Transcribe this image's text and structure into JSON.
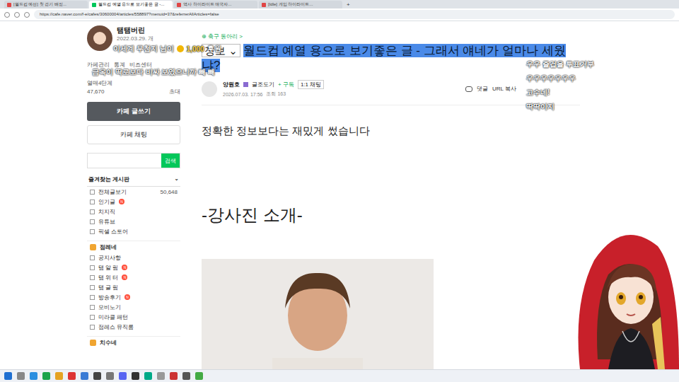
{
  "browser": {
    "tabs": [
      {
        "label": "[월드컵 예선] 첫 경기 배정...",
        "selected": false
      },
      {
        "label": "월드컵 예열 용으로 보기좋은 글 -...",
        "selected": true
      },
      {
        "label": "역사 하이라이트 애국자...",
        "selected": false
      },
      {
        "label": "[Idle] 게임 하이라이트...",
        "selected": false
      }
    ],
    "new_tab": "+",
    "url": "https://cafe.naver.com/f-e/cafes/30600004/articles/558897?menuid=37&referrerAllArticles=false"
  },
  "profile": {
    "name": "탬탬버린",
    "date": "2022.03.29. 개",
    "links": [
      "카페관리",
      "통계",
      "비즈센터"
    ],
    "level": "열매4단계",
    "members": "47,670",
    "invite": "초대"
  },
  "sidebar": {
    "write_button": "카페 글쓰기",
    "chat_button": "카페 채팅",
    "search_button": "검색",
    "favorites": "즐겨찾는 게시판",
    "items": [
      {
        "kind": "item",
        "label": "전체글보기",
        "count": "50,648",
        "badge": ""
      },
      {
        "kind": "item",
        "label": "인기글",
        "count": "",
        "badge": "N"
      },
      {
        "kind": "item",
        "label": "치지직",
        "count": "",
        "badge": ""
      },
      {
        "kind": "item",
        "label": "유튜브",
        "count": "",
        "badge": ""
      },
      {
        "kind": "item",
        "label": "픽셀 스토어",
        "count": "",
        "badge": ""
      },
      {
        "kind": "header",
        "label": "점례네",
        "count": "",
        "badge": ""
      },
      {
        "kind": "item",
        "label": "공지사항",
        "count": "",
        "badge": ""
      },
      {
        "kind": "item",
        "label": "탬 알 림",
        "count": "",
        "badge": "N"
      },
      {
        "kind": "item",
        "label": "탬 위 터",
        "count": "",
        "badge": "N"
      },
      {
        "kind": "item",
        "label": "탬 글 림",
        "count": "",
        "badge": ""
      },
      {
        "kind": "item",
        "label": "방송후기",
        "count": "",
        "badge": "N"
      },
      {
        "kind": "item",
        "label": "모비노기",
        "count": "",
        "badge": ""
      },
      {
        "kind": "item",
        "label": "미라클 패턴",
        "count": "",
        "badge": ""
      },
      {
        "kind": "item",
        "label": "점레스 뮤직룸",
        "count": "",
        "badge": ""
      },
      {
        "kind": "header",
        "label": "치수네",
        "count": "",
        "badge": ""
      }
    ]
  },
  "article": {
    "board": "⊕ 축구 동아리 >",
    "category": "정보 ⌄",
    "title": "월드컵 예열 용으로 보기좋은 글 - 그래서 얘네가 얼마나 세웠냐?",
    "author": "양원호",
    "grade": "글조도기",
    "subscribe": "+ 구독",
    "chat": "1:1 채팅",
    "date": "2026.07.03. 17:56",
    "views": "조회 163",
    "comment": "댓글",
    "url_copy": "URL 복사",
    "intro": "정확한 정보보다는 재밌게 썼습니다",
    "heading": "-강사진 소개-"
  },
  "overlay": {
    "donation_name": "이세계 무첨지 님이",
    "donation_amount": "1,000",
    "donation_suffix": "후원",
    "message": "금옥이 딱로보다 비싸 보였으니까 빼 빼",
    "chat": [
      "우우 즐겁을 투표거부",
      "우우우우우우우",
      "고수네!",
      "딱딱이지"
    ]
  }
}
